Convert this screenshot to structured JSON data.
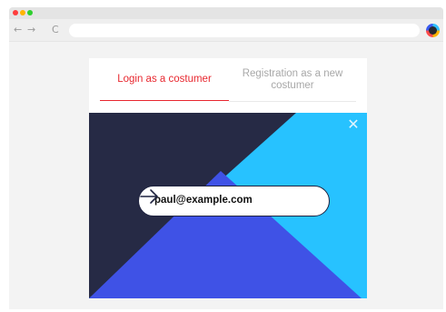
{
  "browser": {
    "icons": {
      "back": "arrow-left-icon",
      "forward": "arrow-right-icon",
      "reload": "reload-icon",
      "extension": "extension-icon"
    },
    "glyphs": {
      "back": "←",
      "forward": "→",
      "reload": "C"
    },
    "url": ""
  },
  "tabs": {
    "login_label": "Login as a costumer",
    "register_label": "Registration as a new costumer",
    "active": "login"
  },
  "form": {
    "email_value": "paul@example.com",
    "close_glyph": "✕",
    "submit_icon": "arrow-right-icon"
  },
  "colors": {
    "accent_red": "#e8272f",
    "navy": "#262a45",
    "cyan": "#27c2ff",
    "royal_blue": "#3f52e6"
  }
}
